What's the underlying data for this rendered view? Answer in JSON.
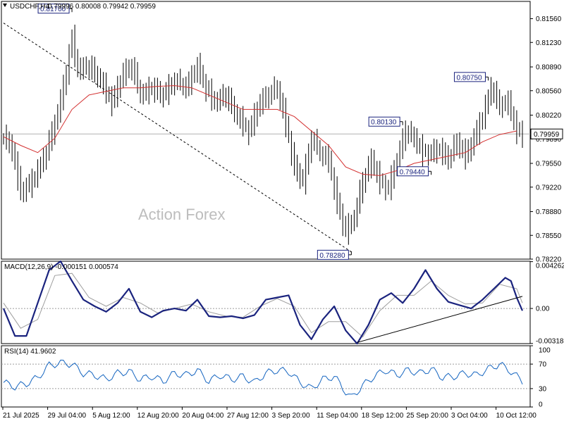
{
  "header": {
    "symbol": "USDCHF,H4",
    "ohlc": "0.79996 0.80008 0.79942 0.79959"
  },
  "watermark": "Action Forex",
  "chart_data": [
    {
      "type": "candlestick",
      "title": "USDCHF,H4",
      "ylim": [
        0.7822,
        0.818
      ],
      "y_ticks": [
        "0.81560",
        "0.81230",
        "0.80890",
        "0.80560",
        "0.80220",
        "0.79890",
        "0.79550",
        "0.79220",
        "0.78880",
        "0.78550",
        "0.78220"
      ],
      "x_ticks": [
        "21 Jul 2025",
        "29 Jul 04:00",
        "5 Aug 12:00",
        "12 Aug 20:00",
        "20 Aug 04:00",
        "27 Aug 12:00",
        "3 Sep 20:00",
        "11 Sep 04:00",
        "18 Sep 12:00",
        "25 Sep 20:00",
        "3 Oct 04:00",
        "10 Oct 12:00"
      ],
      "current_price": "0.79959",
      "current_value": 0.79959,
      "annotations": [
        {
          "label": "0.81700",
          "value": 0.817,
          "at_bar": 24
        },
        {
          "label": "0.80130",
          "value": 0.8013,
          "at_bar": 140
        },
        {
          "label": "0.80750",
          "value": 0.8075,
          "at_bar": 170
        },
        {
          "label": "0.79440",
          "value": 0.7944,
          "at_bar": 150
        },
        {
          "label": "0.78280",
          "value": 0.7828,
          "at_bar": 122
        }
      ],
      "series": [
        {
          "kind": "close",
          "points": [
            [
              0,
              0.7992
            ],
            [
              3,
              0.7975
            ],
            [
              6,
              0.7915
            ],
            [
              10,
              0.793
            ],
            [
              14,
              0.796
            ],
            [
              18,
              0.801
            ],
            [
              21,
              0.806
            ],
            [
              24,
              0.813
            ],
            [
              26,
              0.8085
            ],
            [
              30,
              0.809
            ],
            [
              34,
              0.807
            ],
            [
              38,
              0.804
            ],
            [
              42,
              0.808
            ],
            [
              45,
              0.809
            ],
            [
              48,
              0.805
            ],
            [
              52,
              0.806
            ],
            [
              56,
              0.805
            ],
            [
              60,
              0.807
            ],
            [
              64,
              0.806
            ],
            [
              68,
              0.809
            ],
            [
              71,
              0.806
            ],
            [
              74,
              0.804
            ],
            [
              78,
              0.805
            ],
            [
              82,
              0.802
            ],
            [
              86,
              0.8
            ],
            [
              90,
              0.804
            ],
            [
              93,
              0.805
            ],
            [
              96,
              0.806
            ],
            [
              99,
              0.801
            ],
            [
              102,
              0.795
            ],
            [
              105,
              0.793
            ],
            [
              108,
              0.799
            ],
            [
              111,
              0.797
            ],
            [
              114,
              0.796
            ],
            [
              117,
              0.79
            ],
            [
              120,
              0.786
            ],
            [
              123,
              0.788
            ],
            [
              126,
              0.793
            ],
            [
              129,
              0.796
            ],
            [
              132,
              0.793
            ],
            [
              135,
              0.792
            ],
            [
              138,
              0.796
            ],
            [
              141,
              0.8
            ],
            [
              144,
              0.799
            ],
            [
              147,
              0.797
            ],
            [
              150,
              0.797
            ],
            [
              153,
              0.7975
            ],
            [
              156,
              0.796
            ],
            [
              159,
              0.7985
            ],
            [
              162,
              0.7965
            ],
            [
              165,
              0.799
            ],
            [
              168,
              0.802
            ],
            [
              171,
              0.806
            ],
            [
              174,
              0.8035
            ],
            [
              177,
              0.804
            ],
            [
              180,
              0.8
            ],
            [
              182,
              0.7996
            ]
          ]
        },
        {
          "kind": "moving_average",
          "color": "#d32f2f",
          "points": [
            [
              0,
              0.7992
            ],
            [
              6,
              0.798
            ],
            [
              12,
              0.797
            ],
            [
              18,
              0.799
            ],
            [
              24,
              0.803
            ],
            [
              30,
              0.805
            ],
            [
              36,
              0.8055
            ],
            [
              42,
              0.806
            ],
            [
              48,
              0.806
            ],
            [
              54,
              0.8062
            ],
            [
              60,
              0.8063
            ],
            [
              66,
              0.806
            ],
            [
              72,
              0.805
            ],
            [
              78,
              0.804
            ],
            [
              84,
              0.803
            ],
            [
              90,
              0.803
            ],
            [
              96,
              0.803
            ],
            [
              102,
              0.802
            ],
            [
              108,
              0.8
            ],
            [
              114,
              0.798
            ],
            [
              120,
              0.795
            ],
            [
              126,
              0.794
            ],
            [
              132,
              0.7938
            ],
            [
              138,
              0.7945
            ],
            [
              144,
              0.7955
            ],
            [
              150,
              0.796
            ],
            [
              156,
              0.7965
            ],
            [
              162,
              0.797
            ],
            [
              168,
              0.7985
            ],
            [
              174,
              0.7995
            ],
            [
              180,
              0.8
            ]
          ]
        },
        {
          "kind": "trendline",
          "style": "dashed",
          "points": [
            [
              0,
              0.815
            ],
            [
              122,
              0.7832
            ]
          ]
        }
      ]
    },
    {
      "type": "line",
      "title": "MACD(12,26,9) -0.000151 0.000574",
      "ylim": [
        -0.0032,
        0.0043
      ],
      "y_ticks": [
        "0.004262",
        "0.00",
        "-0.003188"
      ],
      "series": [
        {
          "kind": "macd",
          "color": "#1a237e",
          "points": [
            [
              0,
              0
            ],
            [
              4,
              -0.0025
            ],
            [
              8,
              -0.0025
            ],
            [
              12,
              0.0005
            ],
            [
              16,
              0.0035
            ],
            [
              20,
              0.0043
            ],
            [
              24,
              0.0025
            ],
            [
              28,
              0.0008
            ],
            [
              32,
              0.0002
            ],
            [
              36,
              -0.0003
            ],
            [
              40,
              0.0005
            ],
            [
              44,
              0.0018
            ],
            [
              48,
              -0.0003
            ],
            [
              52,
              -0.0008
            ],
            [
              56,
              -0.0002
            ],
            [
              60,
              0.0
            ],
            [
              64,
              -0.0002
            ],
            [
              68,
              0.0008
            ],
            [
              72,
              -0.0007
            ],
            [
              76,
              -0.0008
            ],
            [
              80,
              -0.0007
            ],
            [
              84,
              -0.0009
            ],
            [
              88,
              -0.0006
            ],
            [
              92,
              0.0008
            ],
            [
              96,
              0.001
            ],
            [
              100,
              0.0012
            ],
            [
              104,
              -0.0015
            ],
            [
              108,
              -0.0028
            ],
            [
              112,
              -0.001
            ],
            [
              116,
              0.0002
            ],
            [
              120,
              -0.002
            ],
            [
              124,
              -0.0032
            ],
            [
              128,
              -0.0015
            ],
            [
              132,
              0.0008
            ],
            [
              136,
              0.0014
            ],
            [
              140,
              0.0005
            ],
            [
              144,
              0.0018
            ],
            [
              148,
              0.0035
            ],
            [
              152,
              0.0018
            ],
            [
              156,
              0.0006
            ],
            [
              160,
              0.0003
            ],
            [
              164,
              0.0
            ],
            [
              168,
              0.0008
            ],
            [
              172,
              0.0018
            ],
            [
              176,
              0.0028
            ],
            [
              178,
              0.0025
            ],
            [
              180,
              0.001
            ],
            [
              182,
              -0.0002
            ]
          ]
        },
        {
          "kind": "signal",
          "color": "#9e9e9e",
          "points": [
            [
              0,
              0.0005
            ],
            [
              6,
              -0.0018
            ],
            [
              12,
              -0.001
            ],
            [
              18,
              0.003
            ],
            [
              24,
              0.0032
            ],
            [
              30,
              0.001
            ],
            [
              36,
              0.0002
            ],
            [
              42,
              0.001
            ],
            [
              48,
              0.0005
            ],
            [
              54,
              -0.0004
            ],
            [
              60,
              0.0
            ],
            [
              66,
              0.0004
            ],
            [
              72,
              -0.0003
            ],
            [
              78,
              -0.0007
            ],
            [
              84,
              -0.0008
            ],
            [
              90,
              0.0002
            ],
            [
              96,
              0.0009
            ],
            [
              102,
              0.0002
            ],
            [
              108,
              -0.0022
            ],
            [
              114,
              -0.0012
            ],
            [
              120,
              -0.0012
            ],
            [
              126,
              -0.0026
            ],
            [
              132,
              -0.0002
            ],
            [
              138,
              0.0012
            ],
            [
              144,
              0.0012
            ],
            [
              150,
              0.0025
            ],
            [
              156,
              0.0012
            ],
            [
              162,
              0.0004
            ],
            [
              168,
              0.0005
            ],
            [
              174,
              0.0022
            ],
            [
              180,
              0.0018
            ],
            [
              182,
              0.0005
            ]
          ]
        },
        {
          "kind": "trendline",
          "color": "#000000",
          "points": [
            [
              124,
              -0.0031
            ],
            [
              182,
              0.0011
            ]
          ]
        }
      ]
    },
    {
      "type": "line",
      "title": "RSI(14) 41.9602",
      "ylim": [
        0,
        100
      ],
      "y_ticks": [
        "100",
        "70",
        "30",
        "0"
      ],
      "levels": [
        70,
        30
      ],
      "series": [
        {
          "kind": "rsi",
          "color": "#1565c0",
          "points": [
            [
              0,
              40
            ],
            [
              4,
              33
            ],
            [
              8,
              38
            ],
            [
              12,
              48
            ],
            [
              16,
              68
            ],
            [
              20,
              72
            ],
            [
              24,
              70
            ],
            [
              28,
              55
            ],
            [
              32,
              52
            ],
            [
              36,
              45
            ],
            [
              40,
              55
            ],
            [
              44,
              58
            ],
            [
              48,
              45
            ],
            [
              52,
              50
            ],
            [
              56,
              42
            ],
            [
              60,
              55
            ],
            [
              64,
              52
            ],
            [
              68,
              60
            ],
            [
              72,
              42
            ],
            [
              76,
              52
            ],
            [
              80,
              45
            ],
            [
              84,
              50
            ],
            [
              88,
              40
            ],
            [
              92,
              55
            ],
            [
              96,
              60
            ],
            [
              100,
              58
            ],
            [
              104,
              40
            ],
            [
              108,
              30
            ],
            [
              112,
              45
            ],
            [
              116,
              50
            ],
            [
              120,
              25
            ],
            [
              122,
              15
            ],
            [
              126,
              35
            ],
            [
              130,
              50
            ],
            [
              134,
              60
            ],
            [
              138,
              52
            ],
            [
              142,
              60
            ],
            [
              146,
              55
            ],
            [
              150,
              62
            ],
            [
              154,
              48
            ],
            [
              158,
              50
            ],
            [
              162,
              55
            ],
            [
              166,
              52
            ],
            [
              170,
              62
            ],
            [
              174,
              70
            ],
            [
              178,
              58
            ],
            [
              182,
              42
            ]
          ]
        }
      ]
    }
  ]
}
